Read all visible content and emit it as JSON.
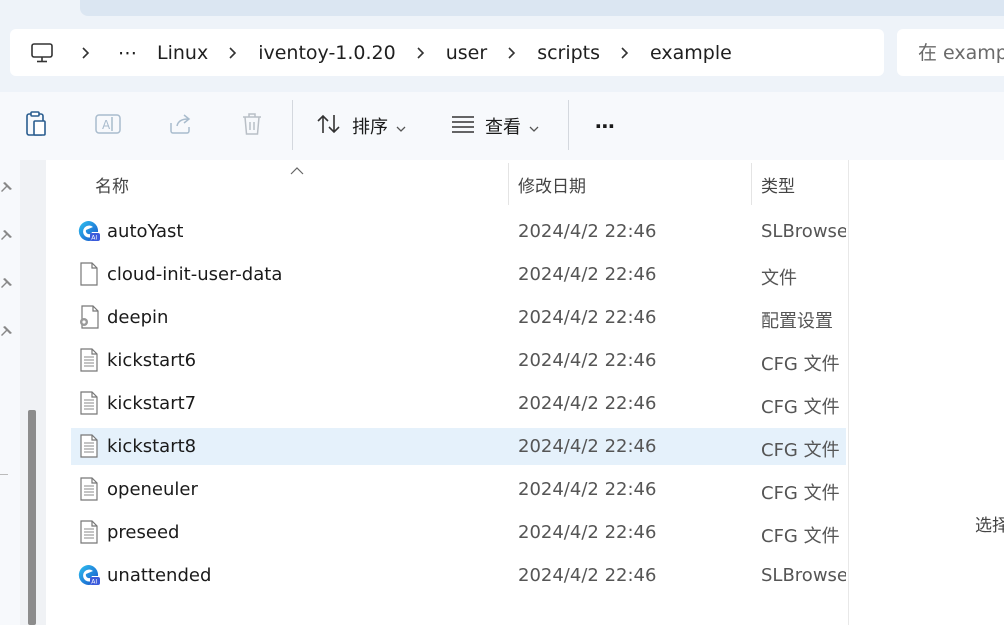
{
  "address": {
    "breadcrumbs": [
      "Linux",
      "iventoy-1.0.20",
      "user",
      "scripts",
      "example"
    ],
    "overflow": "⋯"
  },
  "search": {
    "placeholder": "在 examp"
  },
  "toolbar": {
    "sort_label": "排序",
    "view_label": "查看",
    "more": "⋯"
  },
  "columns": {
    "name": "名称",
    "date": "修改日期",
    "type": "类型"
  },
  "files": [
    {
      "name": "autoYast",
      "date": "2024/4/2 22:46",
      "type": "SLBrowser",
      "icon": "browser-file-icon"
    },
    {
      "name": "cloud-init-user-data",
      "date": "2024/4/2 22:46",
      "type": "文件",
      "icon": "blank-file-icon"
    },
    {
      "name": "deepin",
      "date": "2024/4/2 22:46",
      "type": "配置设置",
      "icon": "settings-file-icon"
    },
    {
      "name": "kickstart6",
      "date": "2024/4/2 22:46",
      "type": "CFG 文件",
      "icon": "text-file-icon"
    },
    {
      "name": "kickstart7",
      "date": "2024/4/2 22:46",
      "type": "CFG 文件",
      "icon": "text-file-icon"
    },
    {
      "name": "kickstart8",
      "date": "2024/4/2 22:46",
      "type": "CFG 文件",
      "icon": "text-file-icon",
      "selected": true
    },
    {
      "name": "openeuler",
      "date": "2024/4/2 22:46",
      "type": "CFG 文件",
      "icon": "text-file-icon"
    },
    {
      "name": "preseed",
      "date": "2024/4/2 22:46",
      "type": "CFG 文件",
      "icon": "text-file-icon"
    },
    {
      "name": "unattended",
      "date": "2024/4/2 22:46",
      "type": "SLBrowser",
      "icon": "browser-file-icon"
    }
  ],
  "details_pane": {
    "hint": "选择"
  },
  "colors": {
    "selected_row": "#e5f1fb",
    "accent": "#0a64c8"
  }
}
